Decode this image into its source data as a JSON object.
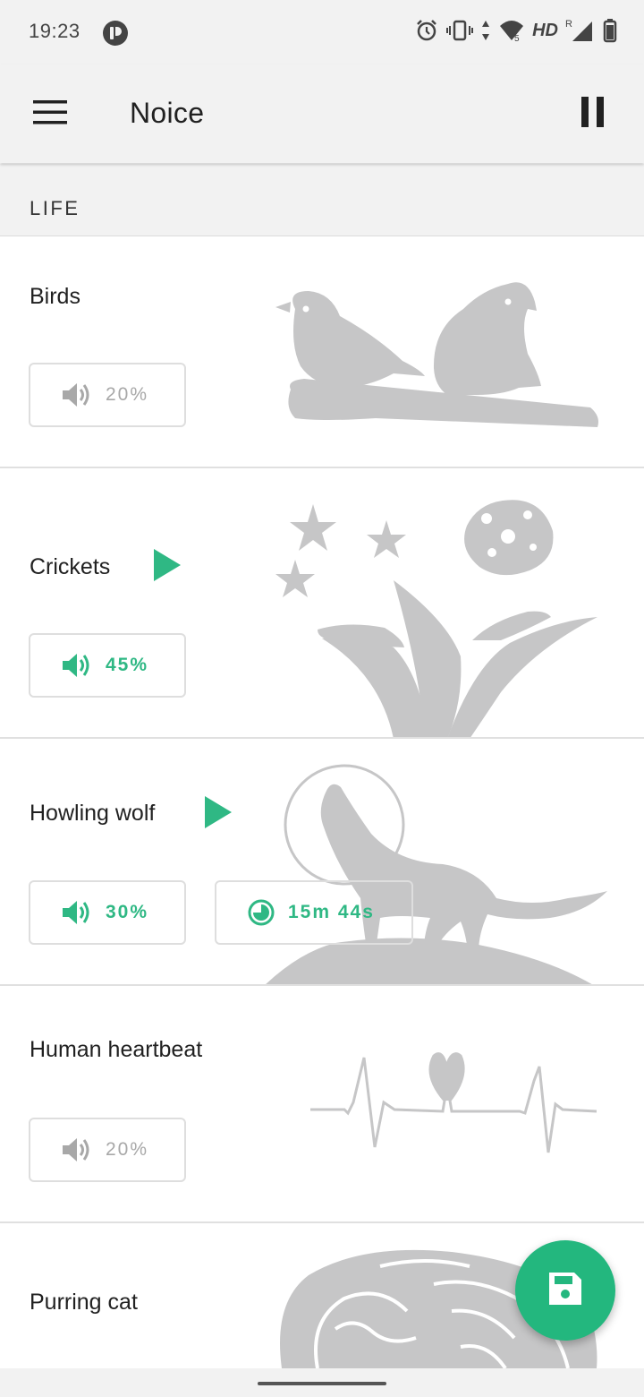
{
  "status": {
    "time": "19:23",
    "network_label": "HD",
    "roaming": "R"
  },
  "appbar": {
    "title": "Noice"
  },
  "section": {
    "title": "LIFE"
  },
  "sounds": [
    {
      "title": "Birds",
      "volume": "20%",
      "playing": false
    },
    {
      "title": "Crickets",
      "volume": "45%",
      "playing": true
    },
    {
      "title": "Howling wolf",
      "volume": "30%",
      "timer": "15m 44s",
      "playing": true
    },
    {
      "title": "Human heartbeat",
      "volume": "20%",
      "playing": false
    },
    {
      "title": "Purring cat"
    }
  ],
  "icons": {
    "menu": "menu-icon",
    "pause": "pause-icon",
    "play": "play-icon",
    "volume": "volume-icon",
    "timer": "timer-icon",
    "save": "save-icon"
  },
  "colors": {
    "accent": "#2fb884",
    "fab": "#23b77e",
    "inactive": "#a8a8a8",
    "art": "#c6c6c7"
  }
}
